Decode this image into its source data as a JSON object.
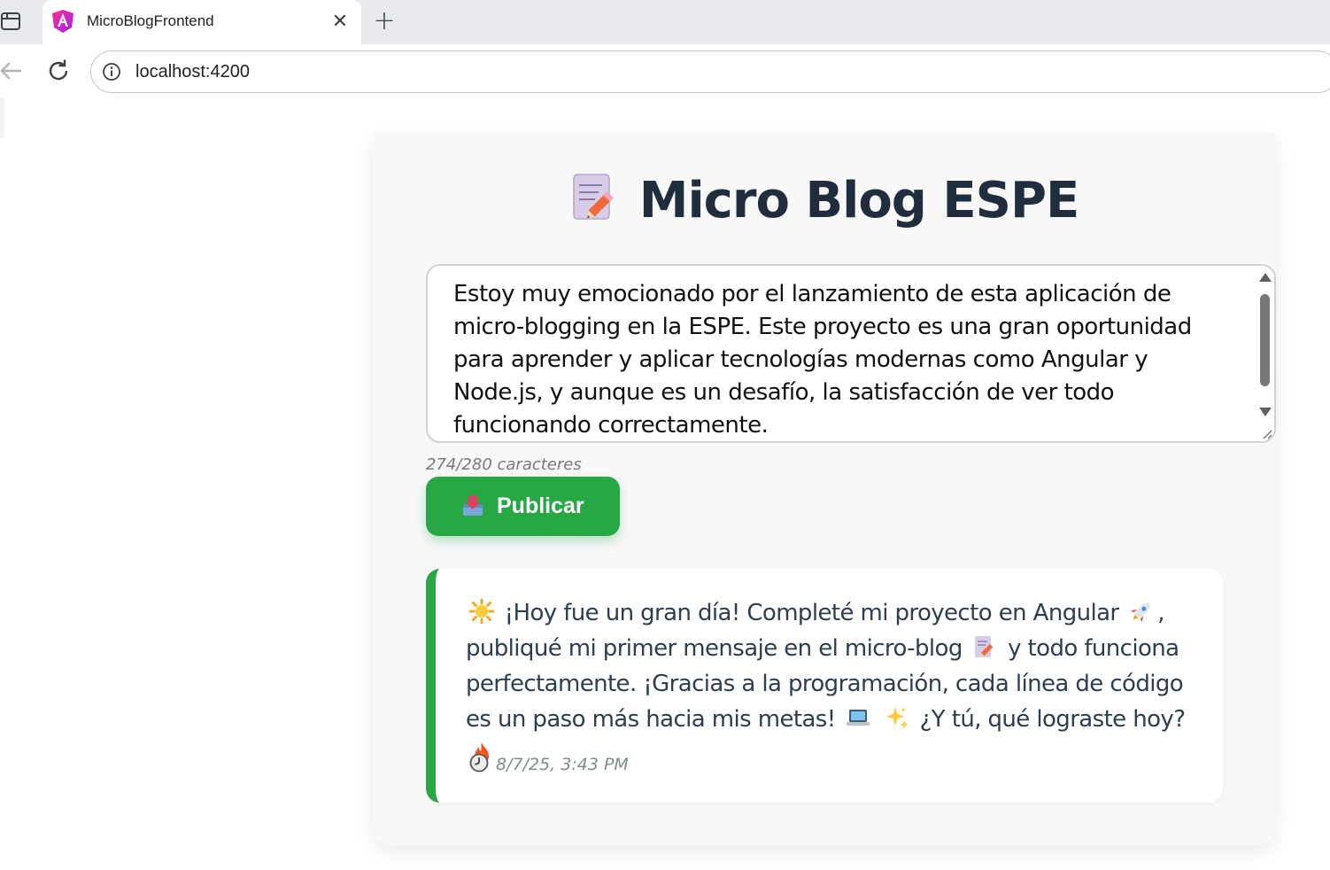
{
  "browser": {
    "tab_title": "MicroBlogFrontend",
    "tab_close": "✕",
    "new_tab": "+",
    "url": "localhost:4200"
  },
  "app": {
    "title": "Micro Blog ESPE",
    "title_icon": "memo-icon",
    "composer_text": "Estoy muy emocionado por el lanzamiento de esta aplicación de micro-blogging en la ESPE. Este proyecto es una gran oportunidad para aprender y aplicar tecnologías modernas como Angular y Node.js, y aunque es un desafío, la satisfacción de ver todo funcionando correctamente.",
    "char_count": "274/280 caracteres",
    "publish_label": "Publicar",
    "publish_icon": "outbox-tray-icon",
    "accent_color": "#28a745"
  },
  "posts": [
    {
      "text_part1": "¡Hoy fue un gran día! Completé mi proyecto en Angular",
      "text_part2": ", publiqué mi primer mensaje en el micro-blog",
      "text_part3": "y todo funciona perfectamente. ¡Gracias a la programación, cada línea de código es un paso más hacia mis metas!",
      "text_part4": "¿Y tú, qué lograste hoy?",
      "timestamp": "8/7/25, 3:43 PM"
    }
  ]
}
